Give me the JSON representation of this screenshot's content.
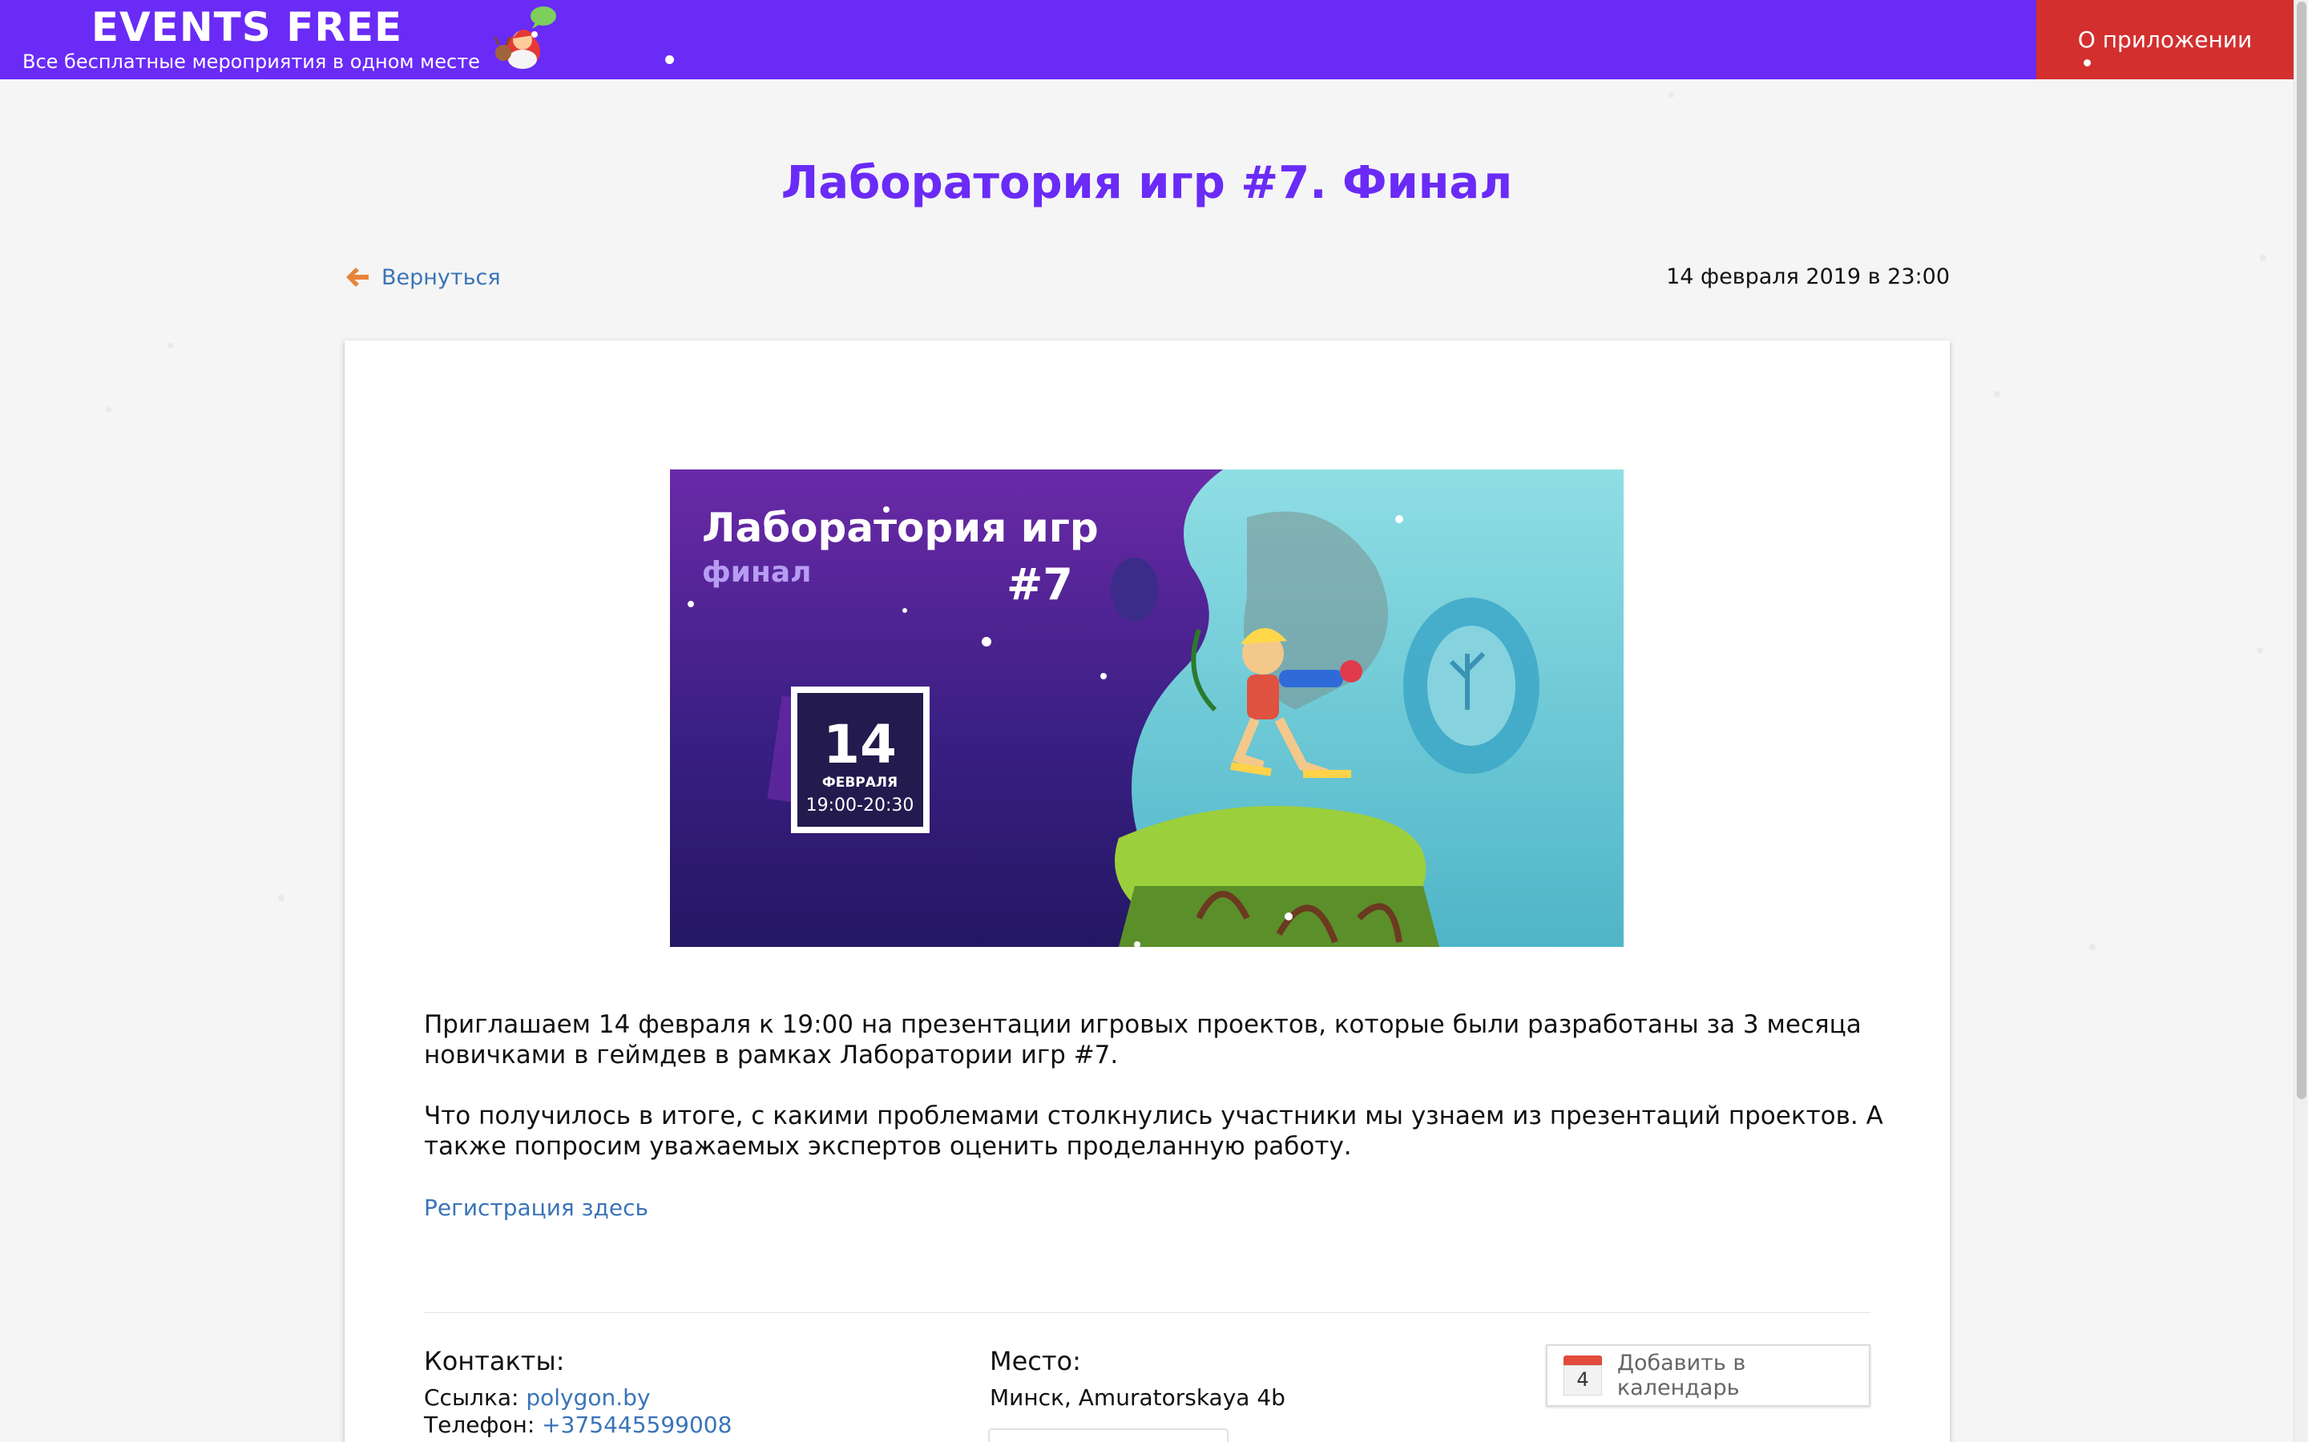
{
  "header": {
    "brand_title": "EVENTS FREE",
    "brand_subtitle": "Все бесплатные мероприятия в одном месте",
    "about_label": "О приложении"
  },
  "page": {
    "title": "Лаборатория игр #7. Финал",
    "back_label": "Вернуться",
    "event_datetime": "14 февраля 2019 в 23:00"
  },
  "banner": {
    "title_line1": "Лаборатория игр",
    "subtitle": "финал",
    "number": "#7",
    "day": "14",
    "month": "ФЕВРАЛЯ",
    "time": "19:00-20:30"
  },
  "description": {
    "paragraph1": "Приглашаем 14 февраля к 19:00 на презентации игровых проектов, которые были разработаны за 3 месяца новичками в геймдев в рамках Лаборатории игр #7.",
    "paragraph2": "Что получилось в итоге, с какими проблемами столкнулись участники мы узнаем из презентаций проектов. А также попросим уважаемых экспертов оценить проделанную работу.",
    "registration_link": "Регистрация здесь"
  },
  "contacts": {
    "heading": "Контакты:",
    "link_label": "Ссылка: ",
    "link_value": "polygon.by",
    "phone_label": "Телефон: ",
    "phone_value": "+375445599008"
  },
  "place": {
    "heading": "Место:",
    "address": "Минск, Amuratorskaya 4b"
  },
  "calendar": {
    "button_label": "Добавить в календарь",
    "icon_day": "4"
  },
  "icons": {
    "back": "arrow-left-icon",
    "santa": "santa-icon",
    "calendar": "calendar-icon"
  },
  "colors": {
    "brand": "#6a2bf7",
    "accent_red": "#d32f2f",
    "link": "#3a74b8",
    "back_arrow": "#e8843a"
  }
}
